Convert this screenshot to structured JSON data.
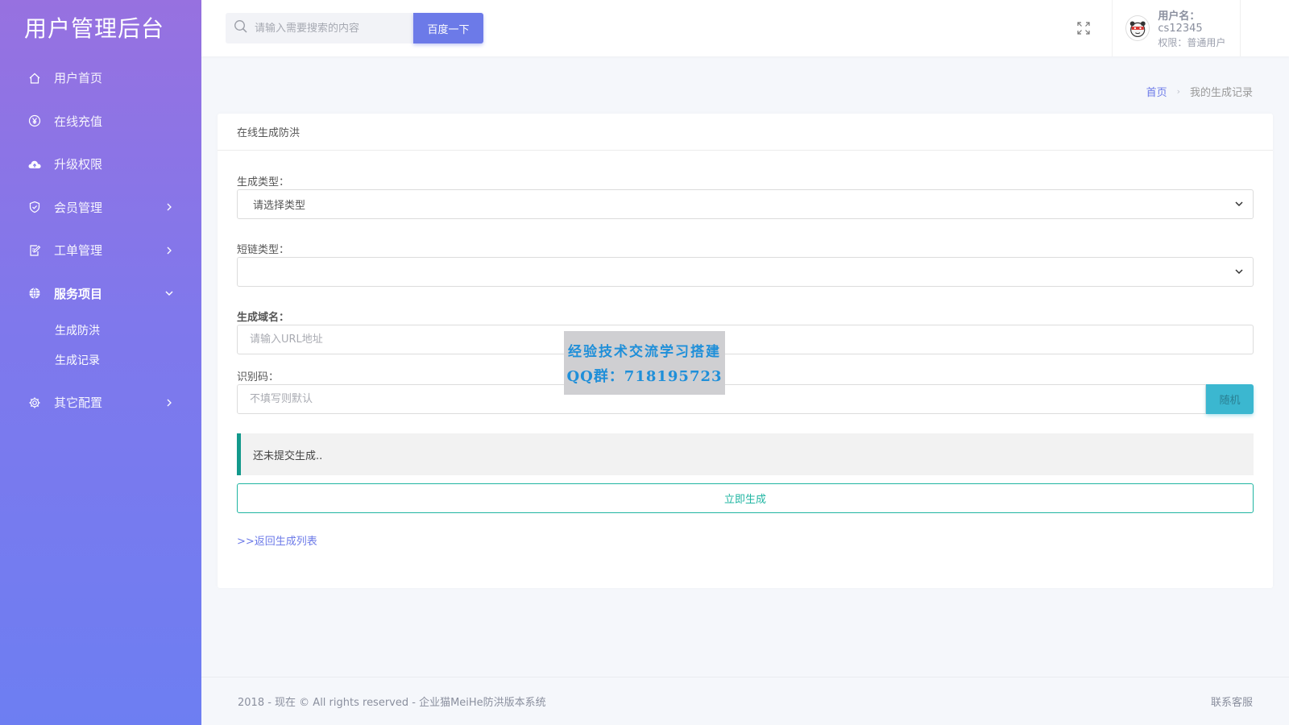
{
  "brand": {
    "title": "用户管理后台"
  },
  "sidebar": {
    "items": [
      {
        "label": "用户首页",
        "icon": "home-icon"
      },
      {
        "label": "在线充值",
        "icon": "yen-icon"
      },
      {
        "label": "升级权限",
        "icon": "cloud-upload-icon"
      },
      {
        "label": "会员管理",
        "icon": "shield-check-icon"
      },
      {
        "label": "工单管理",
        "icon": "edit-document-icon"
      },
      {
        "label": "服务项目",
        "icon": "globe-icon"
      },
      {
        "label": "其它配置",
        "icon": "gear-icon"
      }
    ],
    "submenu": [
      {
        "label": "生成防洪"
      },
      {
        "label": "生成记录"
      }
    ]
  },
  "header": {
    "search_placeholder": "请输入需要搜索的内容",
    "search_button": "百度一下",
    "user": {
      "name_label": "用户名：",
      "name_value": "cs12345",
      "role_label": "权限：普通用户"
    }
  },
  "breadcrumb": {
    "home": "首页",
    "separator": "›",
    "current": "我的生成记录"
  },
  "card": {
    "title": "在线生成防洪",
    "fields": {
      "gen_type_label": "生成类型：",
      "gen_type_value": "请选择类型",
      "link_type_label": "短链类型：",
      "link_type_value": "",
      "domain_label": "生成域名：",
      "domain_placeholder": "请输入URL地址",
      "code_label": "识别码：",
      "code_placeholder": "不填写则默认",
      "random_button": "随机"
    },
    "notice": "还未提交生成..",
    "submit_button": "立即生成",
    "back_link": ">>返回生成列表"
  },
  "watermark": {
    "line1": "经验技术交流学习搭建",
    "line2": "QQ群：718195723"
  },
  "footer": {
    "copyright": "2018 - 现在 © All rights reserved - 企业猫MeiHe防洪版本系统",
    "contact": "联系客服"
  },
  "colors": {
    "accent": "#6c7ae8",
    "sidebar_top": "#9771e0",
    "sidebar_bottom": "#6d7ef2",
    "success": "#1fb5a2",
    "info": "#3bb7d0",
    "notice_border": "#13998c"
  }
}
